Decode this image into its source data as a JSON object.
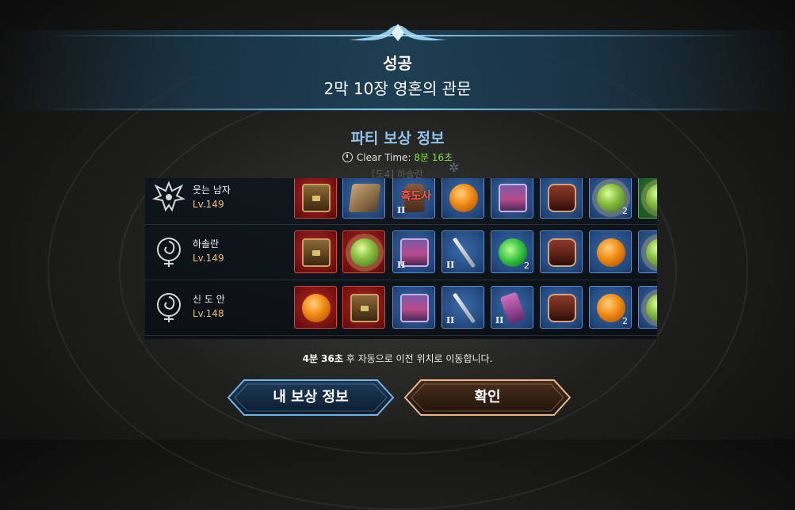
{
  "result": {
    "status": "성공",
    "stage": "2막 10장 영혼의 관문"
  },
  "party": {
    "title": "파티 보상 정보",
    "clear_time_label": "Clear Time:",
    "clear_time_value": "8분 16초",
    "faded_text": "[도4] 하솔란"
  },
  "members": [
    {
      "name": "웃는 남자",
      "level": "Lv.149",
      "emblem": "winged-crest-icon",
      "rewards": [
        {
          "kind": "chest",
          "frame": "red"
        },
        {
          "kind": "book",
          "frame": "blue"
        },
        {
          "kind": "boots",
          "frame": "blue",
          "grade": "II",
          "overlay": "흑도사"
        },
        {
          "kind": "orange",
          "frame": "blue"
        },
        {
          "kind": "pchest",
          "frame": "blue"
        },
        {
          "kind": "bchest",
          "frame": "blue"
        },
        {
          "kind": "gorb",
          "frame": "blue",
          "count": "2"
        },
        {
          "kind": "gorb",
          "frame": "green"
        }
      ]
    },
    {
      "name": "하솔란",
      "level": "Lv.149",
      "emblem": "spiral-crest-icon",
      "rewards": [
        {
          "kind": "chest",
          "frame": "red"
        },
        {
          "kind": "gorb",
          "frame": "red"
        },
        {
          "kind": "pchest",
          "frame": "blue",
          "grade": "II"
        },
        {
          "kind": "sword",
          "frame": "blue",
          "grade": "II"
        },
        {
          "kind": "amulet",
          "frame": "blue",
          "count": "2"
        },
        {
          "kind": "bchest",
          "frame": "blue"
        },
        {
          "kind": "orange",
          "frame": "blue"
        },
        {
          "kind": "gorb",
          "frame": "blue"
        }
      ]
    },
    {
      "name": "신 도 안",
      "level": "Lv.148",
      "emblem": "spiral-crest-icon",
      "rewards": [
        {
          "kind": "orange",
          "frame": "red"
        },
        {
          "kind": "chest",
          "frame": "red"
        },
        {
          "kind": "pchest",
          "frame": "blue"
        },
        {
          "kind": "sword",
          "frame": "blue",
          "grade": "II"
        },
        {
          "kind": "bracer",
          "frame": "blue",
          "grade": "II"
        },
        {
          "kind": "bchest",
          "frame": "blue"
        },
        {
          "kind": "orange",
          "frame": "blue",
          "count": "2"
        },
        {
          "kind": "gorb",
          "frame": "blue"
        }
      ]
    }
  ],
  "notice": {
    "time": "4분 36초",
    "text": " 후 자동으로 이전 위치로 이동합니다."
  },
  "buttons": {
    "my_reward": "내 보상 정보",
    "confirm": "확인"
  },
  "colors": {
    "accent_blue": "#8fc3ee",
    "level_gold": "#e8c26a",
    "clear_green": "#7fe04a"
  }
}
